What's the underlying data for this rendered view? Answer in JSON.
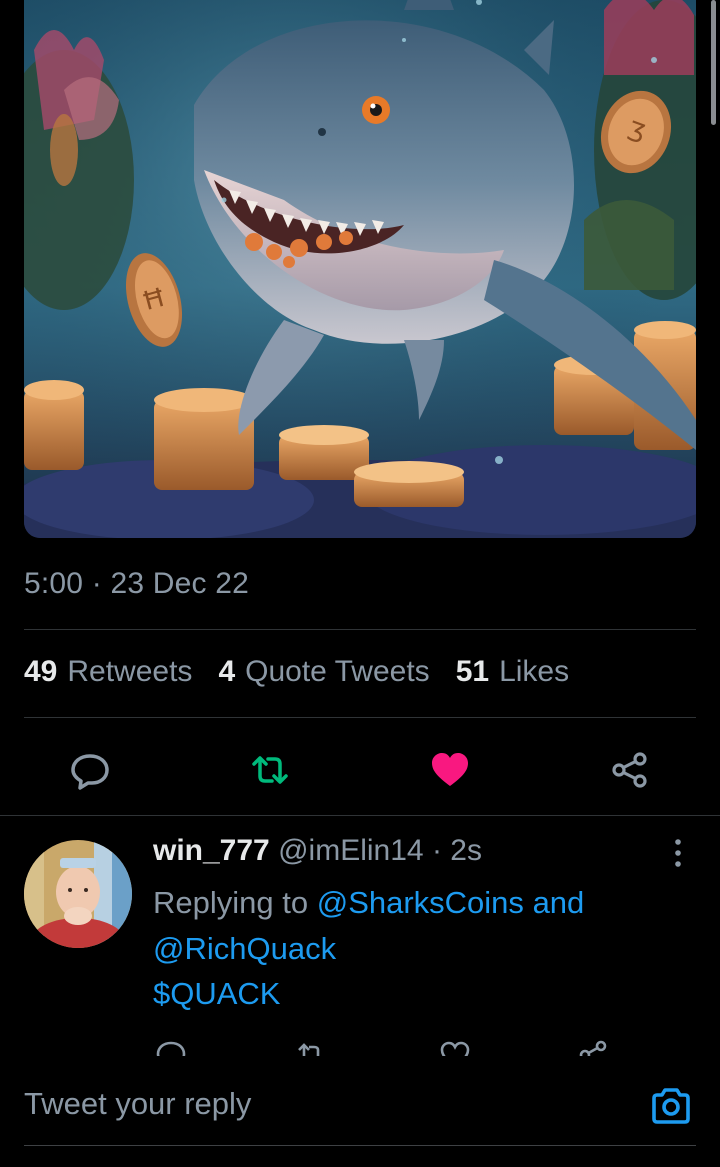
{
  "tweet": {
    "timestamp": "5:00 · 23 Dec 22",
    "stats": {
      "retweets_count": "49",
      "retweets_label": "Retweets",
      "quotes_count": "4",
      "quotes_label": "Quote Tweets",
      "likes_count": "51",
      "likes_label": "Likes"
    },
    "actions": {
      "reply_icon": "reply-icon",
      "retweet_icon": "retweet-icon",
      "like_icon": "heart-icon",
      "share_icon": "share-icon"
    },
    "media_alt": ""
  },
  "reply": {
    "display_name": "win_777",
    "handle": "@imElin14",
    "time": "· 2s",
    "replying_prefix": "Replying to",
    "mention_1": "@SharksCoins",
    "conjunction": "and",
    "mention_2": "@RichQuack",
    "body": "$QUACK"
  },
  "composer": {
    "placeholder": "Tweet your reply"
  },
  "colors": {
    "background": "#000000",
    "accent": "#1d9bf0",
    "retweet": "#00ba7c",
    "like": "#f91880",
    "muted": "#8b98a5"
  }
}
